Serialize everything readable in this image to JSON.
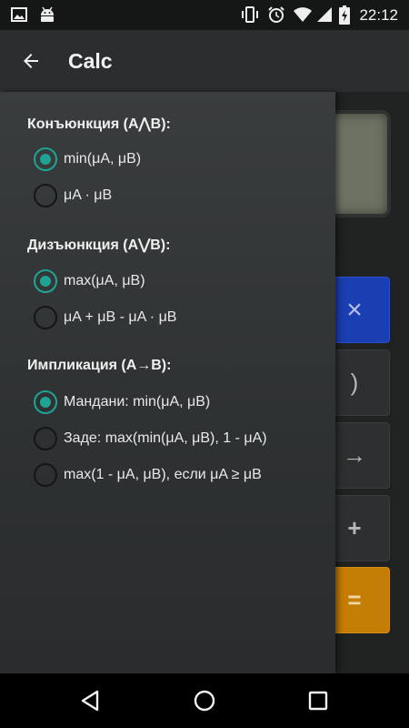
{
  "status_bar": {
    "time": "22:12",
    "left_icons": [
      "image-icon",
      "android-icon"
    ],
    "right_icons": [
      "vibrate-icon",
      "alarm-icon",
      "wifi-icon",
      "signal-icon",
      "battery-charging-icon"
    ]
  },
  "toolbar": {
    "title": "Calc",
    "back_icon": "arrow-left-icon"
  },
  "calculator": {
    "keys": {
      "multiply": "×",
      "paren": ")",
      "implication": "→",
      "plus": "+",
      "equals": "="
    },
    "colors": {
      "multiply": "#1a3fb2",
      "equals": "#c47d05",
      "display": "#6d7263"
    }
  },
  "drawer": {
    "accent_color": "#1fa395",
    "sections": [
      {
        "title": "Конъюнкция (A⋀B):",
        "options": [
          {
            "label": "min(μA, μB)",
            "checked": true
          },
          {
            "label": "μA · μB",
            "checked": false
          }
        ]
      },
      {
        "title": "Дизъюнкция (A⋁B):",
        "options": [
          {
            "label": "max(μA, μB)",
            "checked": true
          },
          {
            "label": "μA + μB - μA · μB",
            "checked": false
          }
        ]
      },
      {
        "title": "Импликация (A→B):",
        "options": [
          {
            "label": "Мандани: min(μA, μB)",
            "checked": true
          },
          {
            "label": "Заде: max(min(μA, μB), 1 - μA)",
            "checked": false
          },
          {
            "label": "max(1 - μA, μB), если μA ≥ μB",
            "checked": false
          }
        ]
      }
    ]
  },
  "nav_bar": {
    "icons": [
      "back-triangle-icon",
      "home-circle-icon",
      "recents-square-icon"
    ]
  }
}
